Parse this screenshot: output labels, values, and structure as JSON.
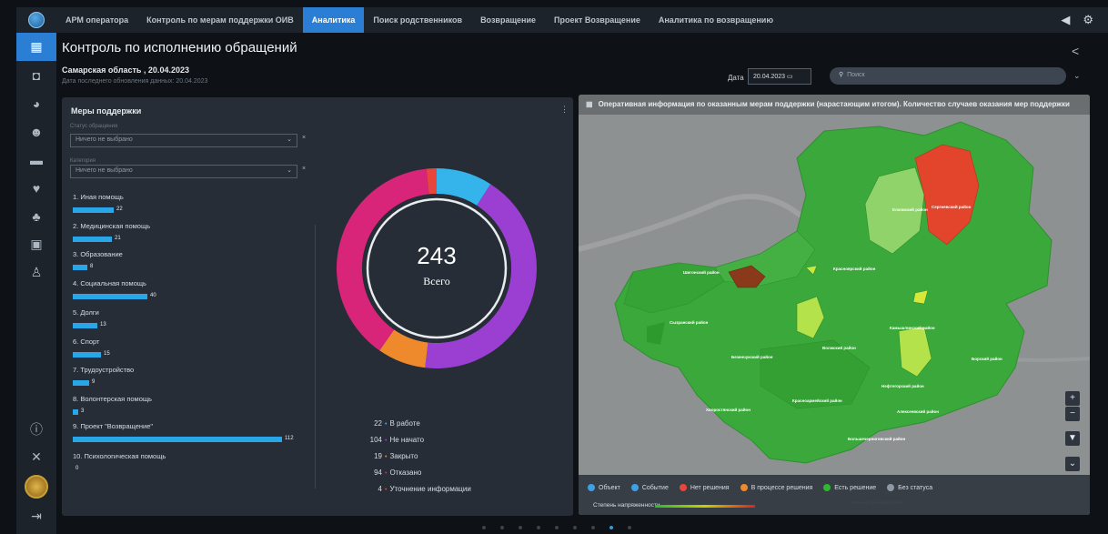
{
  "nav": {
    "tabs": [
      "АРМ оператора",
      "Контроль по мерам поддержки ОИВ",
      "Аналитика",
      "Поиск родственников",
      "Возвращение",
      "Проект Возвращение",
      "Аналитика по возвращению"
    ],
    "active_index": 2
  },
  "header": {
    "title": "Контроль по исполнению обращений",
    "region": "Самарская область , 20.04.2023",
    "last_update": "Дата последнего обновления данных: 20.04.2023",
    "date_label": "Дата",
    "date_value": "20.04.2023",
    "search_placeholder": "Поиск"
  },
  "support": {
    "title": "Меры поддержки",
    "status_label": "Статус обращения",
    "status_value": "Ничего не выбрано",
    "category_label": "Категория",
    "category_value": "Ничего не выбрано",
    "categories": [
      {
        "label": "1. Иная помощь",
        "value": "22"
      },
      {
        "label": "2. Медицинская помощь",
        "value": "21"
      },
      {
        "label": "3. Образование",
        "value": "8"
      },
      {
        "label": "4. Социальная помощь",
        "value": "40"
      },
      {
        "label": "5. Долги",
        "value": "13"
      },
      {
        "label": "6. Спорт",
        "value": "15"
      },
      {
        "label": "7. Трудоустройство",
        "value": "9"
      },
      {
        "label": "8. Волонтерская помощь",
        "value": "3"
      },
      {
        "label": "9. Проект \"Возвращение\"",
        "value": "112"
      },
      {
        "label": "10. Психологическая помощь",
        "value": "0"
      }
    ]
  },
  "donut": {
    "total": "243",
    "total_label": "Всего",
    "segments": [
      {
        "label": "В работе",
        "value": "22",
        "color": "#34b4ea"
      },
      {
        "label": "Не начато",
        "value": "104",
        "color": "#9a3fd2"
      },
      {
        "label": "Закрыто",
        "value": "19",
        "color": "#ef8a2c"
      },
      {
        "label": "Отказано",
        "value": "94",
        "color": "#d8257a"
      },
      {
        "label": "Уточнение информации",
        "value": "4",
        "color": "#e8453c"
      }
    ]
  },
  "map": {
    "title": "Оперативная информация по оказанным мерам поддержки (нарастающим итогом). Количество случаев оказания мер поддержки",
    "districts": [
      "Сергиевский район",
      "Елховский район",
      "Красноярский район",
      "Шигонский район",
      "Сызранский район",
      "Камышлинский район",
      "Безенчукский район",
      "Волжский район",
      "Борский район",
      "Нефтегорский район",
      "Красноармейский район",
      "Алексеевский район",
      "Хворостянский район",
      "Большечерниговский район",
      "Большеглушицкий район"
    ],
    "legend": [
      {
        "label": "Объект",
        "color": "#3ea0e8"
      },
      {
        "label": "Событие",
        "color": "#3ea0e8"
      },
      {
        "label": "Нет решения",
        "color": "#e8453c"
      },
      {
        "label": "В процессе решения",
        "color": "#ef8a2c"
      },
      {
        "label": "Есть решение",
        "color": "#2eb82e"
      },
      {
        "label": "Без статуса",
        "color": "#8e99a5"
      }
    ],
    "stress_label": "Степень напряженности"
  }
}
